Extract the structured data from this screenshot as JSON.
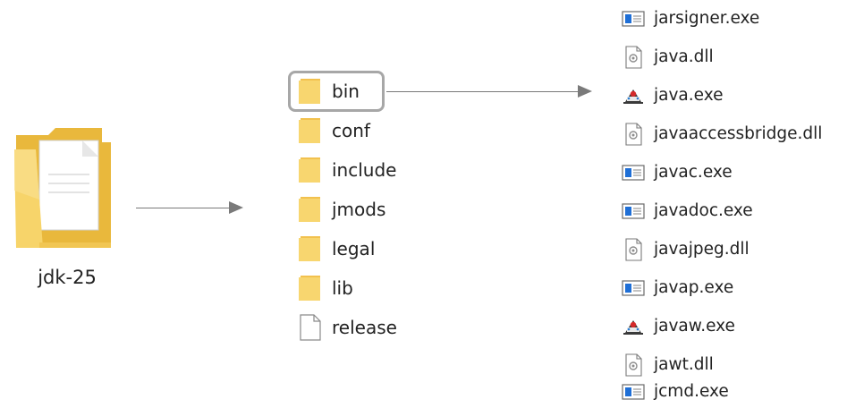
{
  "root": {
    "label": "jdk-25",
    "icon": "folder-with-document-icon"
  },
  "directory": {
    "items": [
      {
        "label": "bin",
        "icon": "folder-icon",
        "highlighted": true
      },
      {
        "label": "conf",
        "icon": "folder-icon"
      },
      {
        "label": "include",
        "icon": "folder-icon"
      },
      {
        "label": "jmods",
        "icon": "folder-icon"
      },
      {
        "label": "legal",
        "icon": "folder-icon"
      },
      {
        "label": "lib",
        "icon": "folder-icon"
      },
      {
        "label": "release",
        "icon": "file-icon"
      }
    ]
  },
  "bin_contents": {
    "items": [
      {
        "label": "jarsigner.exe",
        "icon": "console-app-icon"
      },
      {
        "label": "java.dll",
        "icon": "dll-file-icon"
      },
      {
        "label": "java.exe",
        "icon": "java-app-icon"
      },
      {
        "label": "javaaccessbridge.dll",
        "icon": "dll-file-icon"
      },
      {
        "label": "javac.exe",
        "icon": "console-app-icon"
      },
      {
        "label": "javadoc.exe",
        "icon": "console-app-icon"
      },
      {
        "label": "javajpeg.dll",
        "icon": "dll-file-icon"
      },
      {
        "label": "javap.exe",
        "icon": "console-app-icon"
      },
      {
        "label": "javaw.exe",
        "icon": "java-app-icon"
      },
      {
        "label": "jawt.dll",
        "icon": "dll-file-icon"
      },
      {
        "label": "jcmd.exe",
        "icon": "console-app-icon"
      }
    ]
  },
  "colors": {
    "folder_fill": "#f8d66f",
    "folder_dark": "#e8b73b",
    "arrow": "#7a7a7a",
    "highlight_border": "#a7a7a7",
    "app_icon_blue": "#1f6fd6"
  }
}
